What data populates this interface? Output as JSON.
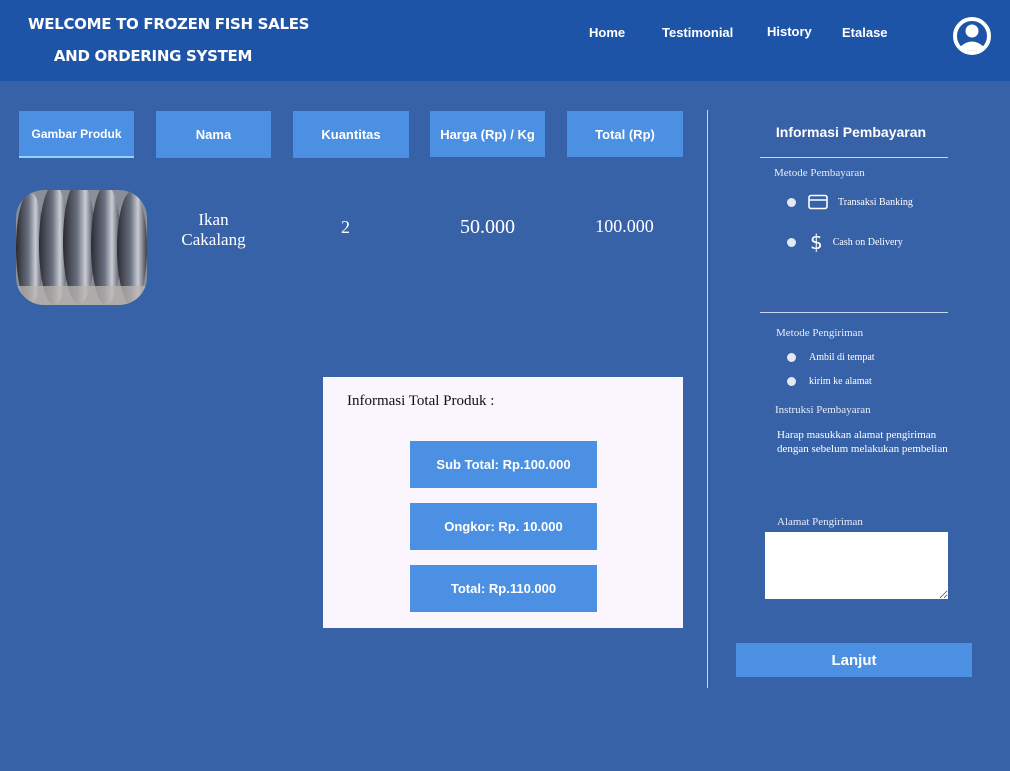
{
  "header": {
    "title_line1": "WELCOME TO FROZEN FISH SALES",
    "title_line2": "AND ORDERING SYSTEM",
    "nav": [
      "Home",
      "Testimonial",
      "History",
      "Etalase"
    ],
    "profile_icon": "user-circle-icon"
  },
  "table": {
    "headers": [
      "Gambar Produk",
      "Nama",
      "Kuantitas",
      "Harga (Rp) / Kg",
      "Total (Rp)"
    ],
    "row": {
      "image": "fish-image",
      "name_line1": "Ikan",
      "name_line2": "Cakalang",
      "quantity": "2",
      "price": "50.000",
      "total": "100.000"
    }
  },
  "summary": {
    "title": "Informasi Total Produk :",
    "subtotal": "Sub Total: Rp.100.000",
    "shipping": "Ongkor: Rp. 10.000",
    "total": "Total: Rp.110.000"
  },
  "payment": {
    "title": "Informasi Pembayaran",
    "method_label": "Metode Pembayaran",
    "methods": [
      {
        "icon": "credit-card-icon",
        "label": "Transaksi Banking"
      },
      {
        "icon": "dollar-icon",
        "label": "Cash on Delivery"
      }
    ],
    "shipping_label": "Metode Pengiriman",
    "shipping_options": [
      "Ambil di tempat",
      "kirim ke alamat"
    ],
    "instruction_label": "Instruksi Pembayaran",
    "instruction_text": "Harap masukkan alamat pengiriman dengan sebelum melakukan pembelian",
    "address_label": "Alamat Pengiriman",
    "submit_label": "Lanjut"
  },
  "colors": {
    "header_bg": "#1e54a8",
    "page_bg": "#3862a8",
    "accent": "#4b90e2",
    "summary_bg": "#fbf5fd"
  }
}
